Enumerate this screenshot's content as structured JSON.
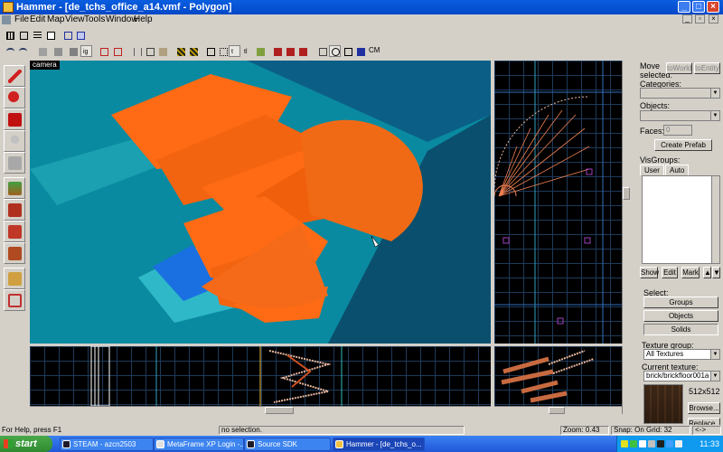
{
  "window": {
    "title": "Hammer - [de_tchs_office_a14.vmf - Polygon]",
    "icons": {
      "app": "hammer-icon",
      "min": "minimize-icon",
      "max": "maximize-icon",
      "close": "close-icon"
    },
    "min_glyph": "_",
    "max_glyph": "□",
    "close_glyph": "×"
  },
  "menu": {
    "items": [
      "File",
      "Edit",
      "Map",
      "View",
      "Tools",
      "Window",
      "Help"
    ],
    "mdi_min_glyph": "_",
    "mdi_restore_glyph": "▫",
    "mdi_close_glyph": "×"
  },
  "toolbar": {
    "cm_label": "CM",
    "icons": [
      "grid-icon",
      "grid-snap-icon",
      "grid-fine-icon",
      "grid-3d-icon",
      "carve-icon",
      "group-icon",
      "undo-icon",
      "redo-icon",
      "new-icon",
      "cut-icon",
      "copy-icon",
      "paste-icon",
      "toggle-texlock-icon",
      "hide-icon",
      "show-icon",
      "quirk-icon",
      "select-icon",
      "vertex-icon",
      "clip-icon",
      "texture-icon",
      "entity-icon",
      "decal-icon",
      "overlay-icon",
      "camera-icon",
      "wireframe-icon",
      "textured-icon",
      "lightmap-icon"
    ]
  },
  "tools": [
    "selection-tool-icon",
    "magnify-tool-icon",
    "camera-tool-icon",
    "entity-tool-icon",
    "block-tool-icon",
    "toggle-texture-tool-icon",
    "apply-texture-tool-icon",
    "apply-decal-tool-icon",
    "apply-overlay-tool-icon",
    "clipping-tool-icon",
    "vertex-tool-icon"
  ],
  "viewports": {
    "camera_label": "camera"
  },
  "right_panel": {
    "move_selected_label": "Move selected:",
    "to_world_label": "toWorld",
    "to_entity_label": "toEntity",
    "categories_label": "Categories:",
    "objects_label": "Objects:",
    "faces_label": "Faces:",
    "faces_value": "0",
    "create_prefab_label": "Create Prefab",
    "visgroups_label": "VisGroups:",
    "tab_user": "User",
    "tab_auto": "Auto",
    "show_label": "Show",
    "edit_label": "Edit",
    "mark_label": "Mark",
    "select_label": "Select:",
    "groups_label": "Groups",
    "objects_btn_label": "Objects",
    "solids_label": "Solids",
    "texture_group_label": "Texture group:",
    "texture_group_value": "All Textures",
    "current_texture_label": "Current texture:",
    "current_texture_value": "brick/brickfloor001a",
    "texture_size": "512x512",
    "browse_label": "Browse...",
    "replace_label": "Replace...",
    "up_glyph": "▲",
    "down_glyph": "▼"
  },
  "status": {
    "help": "For Help, press F1",
    "selection": "no selection.",
    "zoom": "Zoom: 0.43",
    "snap": "Snap: On Grid: 32",
    "end": "<->"
  },
  "taskbar": {
    "start_label": "start",
    "tasks": [
      {
        "label": "STEAM - azcn2503",
        "icon": "steam-icon"
      },
      {
        "label": "MetaFrame XP Login -...",
        "icon": "metaframe-icon"
      },
      {
        "label": "Source SDK",
        "icon": "steam-icon"
      },
      {
        "label": "Hammer - [de_tchs_o...",
        "icon": "hammer-icon"
      }
    ],
    "clock": "11:33"
  },
  "colors": {
    "floor": "#0a8aa0",
    "wall": "#0b5f86",
    "stairs": "#ff6a14",
    "wire": "#e8b8a0"
  }
}
